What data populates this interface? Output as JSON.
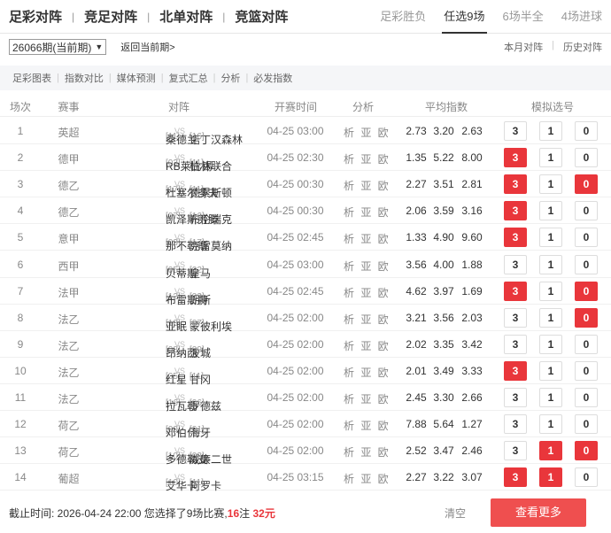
{
  "nav": {
    "main_tabs": [
      "足彩对阵",
      "竞足对阵",
      "北单对阵",
      "竞篮对阵"
    ],
    "sub_tabs": [
      "足彩胜负",
      "任选9场",
      "6场半全",
      "4场进球"
    ],
    "active_sub_tab": "任选9场"
  },
  "period": {
    "selected": "26066期(当前期)",
    "back_link": "返回当前期>",
    "links": [
      "本月对阵",
      "历史对阵"
    ]
  },
  "tools": [
    "足彩图表",
    "指数对比",
    "媒体预测",
    "复式汇总",
    "分析",
    "必发指数"
  ],
  "table": {
    "headers": [
      "场次",
      "赛事",
      "对阵",
      "开赛时间",
      "分析",
      "平均指数",
      "模拟选号"
    ],
    "vs_label": "VS",
    "analysis_label": "析 亚 欧",
    "rows": [
      {
        "no": "1",
        "league": "英超",
        "home_rank": "[11]",
        "home": "桑德兰",
        "away": "诺丁汉森林",
        "away_rank": "[16]",
        "time": "04-25 03:00",
        "odds": [
          "2.73",
          "3.20",
          "2.63"
        ],
        "picks": [
          "3",
          "1",
          "0"
        ],
        "selected": [
          false,
          false,
          false
        ]
      },
      {
        "no": "2",
        "league": "德甲",
        "home_rank": "[03]",
        "home": "RB莱比锡",
        "away": "柏林联合",
        "away_rank": "[11]",
        "time": "04-25 02:30",
        "odds": [
          "1.35",
          "5.22",
          "8.00"
        ],
        "picks": [
          "3",
          "1",
          "0"
        ],
        "selected": [
          true,
          false,
          false
        ]
      },
      {
        "no": "3",
        "league": "德乙",
        "home_rank": "[17]",
        "home": "杜塞尔多夫",
        "away": "德累斯顿",
        "away_rank": "[11]",
        "time": "04-25 00:30",
        "odds": [
          "2.27",
          "3.51",
          "2.81"
        ],
        "picks": [
          "3",
          "1",
          "0"
        ],
        "selected": [
          true,
          false,
          true
        ]
      },
      {
        "no": "4",
        "league": "德乙",
        "home_rank": "[07]",
        "home": "凯泽斯劳滕",
        "away": "布伦瑞克",
        "away_rank": "[16]",
        "time": "04-25 00:30",
        "odds": [
          "2.06",
          "3.59",
          "3.16"
        ],
        "picks": [
          "3",
          "1",
          "0"
        ],
        "selected": [
          true,
          false,
          false
        ]
      },
      {
        "no": "5",
        "league": "意甲",
        "home_rank": "[03]",
        "home": "那不勒斯",
        "away": "克雷莫纳",
        "away_rank": "[17]",
        "time": "04-25 02:45",
        "odds": [
          "1.33",
          "4.90",
          "9.60"
        ],
        "picks": [
          "3",
          "1",
          "0"
        ],
        "selected": [
          true,
          false,
          false
        ]
      },
      {
        "no": "6",
        "league": "西甲",
        "home_rank": "[05]",
        "home": "贝蒂斯",
        "away": "皇马",
        "away_rank": "[02]",
        "time": "04-25 03:00",
        "odds": [
          "3.56",
          "4.00",
          "1.88"
        ],
        "picks": [
          "3",
          "1",
          "0"
        ],
        "selected": [
          false,
          false,
          false
        ]
      },
      {
        "no": "7",
        "league": "法甲",
        "home_rank": "[12]",
        "home": "布雷斯特",
        "away": "朗斯",
        "away_rank": "[02]",
        "time": "04-25 02:45",
        "odds": [
          "4.62",
          "3.97",
          "1.69"
        ],
        "picks": [
          "3",
          "1",
          "0"
        ],
        "selected": [
          true,
          false,
          true
        ]
      },
      {
        "no": "8",
        "league": "法乙",
        "home_rank": "[18]",
        "home": "亚眠",
        "away": "蒙彼利埃",
        "away_rank": "[07]",
        "time": "04-25 02:00",
        "odds": [
          "3.21",
          "3.56",
          "2.03"
        ],
        "picks": [
          "3",
          "1",
          "0"
        ],
        "selected": [
          false,
          false,
          true
        ]
      },
      {
        "no": "9",
        "league": "法乙",
        "home_rank": "[08]",
        "home": "昂纳西",
        "away": "波城",
        "away_rank": "[09]",
        "time": "04-25 02:00",
        "odds": [
          "2.02",
          "3.35",
          "3.42"
        ],
        "picks": [
          "3",
          "1",
          "0"
        ],
        "selected": [
          false,
          false,
          false
        ]
      },
      {
        "no": "10",
        "league": "法乙",
        "home_rank": "[05]",
        "home": "红星",
        "away": "甘冈",
        "away_rank": "[11]",
        "time": "04-25 02:00",
        "odds": [
          "2.01",
          "3.49",
          "3.33"
        ],
        "picks": [
          "3",
          "1",
          "0"
        ],
        "selected": [
          true,
          false,
          false
        ]
      },
      {
        "no": "11",
        "league": "法乙",
        "home_rank": "[16]",
        "home": "拉瓦勒",
        "away": "罗德兹",
        "away_rank": "[06]",
        "time": "04-25 02:00",
        "odds": [
          "2.45",
          "3.30",
          "2.66"
        ],
        "picks": [
          "3",
          "1",
          "0"
        ],
        "selected": [
          false,
          false,
          false
        ]
      },
      {
        "no": "12",
        "league": "荷乙",
        "home_rank": "[09]",
        "home": "邓伯什",
        "away": "海牙",
        "away_rank": "[01]",
        "time": "04-25 02:00",
        "odds": [
          "7.88",
          "5.64",
          "1.27"
        ],
        "picks": [
          "3",
          "1",
          "0"
        ],
        "selected": [
          false,
          false,
          false
        ]
      },
      {
        "no": "13",
        "league": "荷乙",
        "home_rank": "[10]",
        "home": "多德勒支",
        "away": "威廉二世",
        "away_rank": "[03]",
        "time": "04-25 02:00",
        "odds": [
          "2.52",
          "3.47",
          "2.46"
        ],
        "picks": [
          "3",
          "1",
          "0"
        ],
        "selected": [
          false,
          true,
          true
        ]
      },
      {
        "no": "14",
        "league": "葡超",
        "home_rank": "[10]",
        "home": "艾华卡",
        "away": "阿罗卡",
        "away_rank": "[11]",
        "time": "04-25 03:15",
        "odds": [
          "2.27",
          "3.22",
          "3.07"
        ],
        "picks": [
          "3",
          "1",
          "0"
        ],
        "selected": [
          true,
          true,
          false
        ]
      }
    ]
  },
  "footer": {
    "deadline_prefix": "截止时间: 2026-04-24 22:00 您选择了9场比赛,",
    "bets": "16",
    "bets_unit": "注 ",
    "amount": "32元",
    "clear": "清空",
    "more": "查看更多"
  },
  "colors": {
    "accent": "#e9363b",
    "more_button": "#ef4f4f"
  }
}
